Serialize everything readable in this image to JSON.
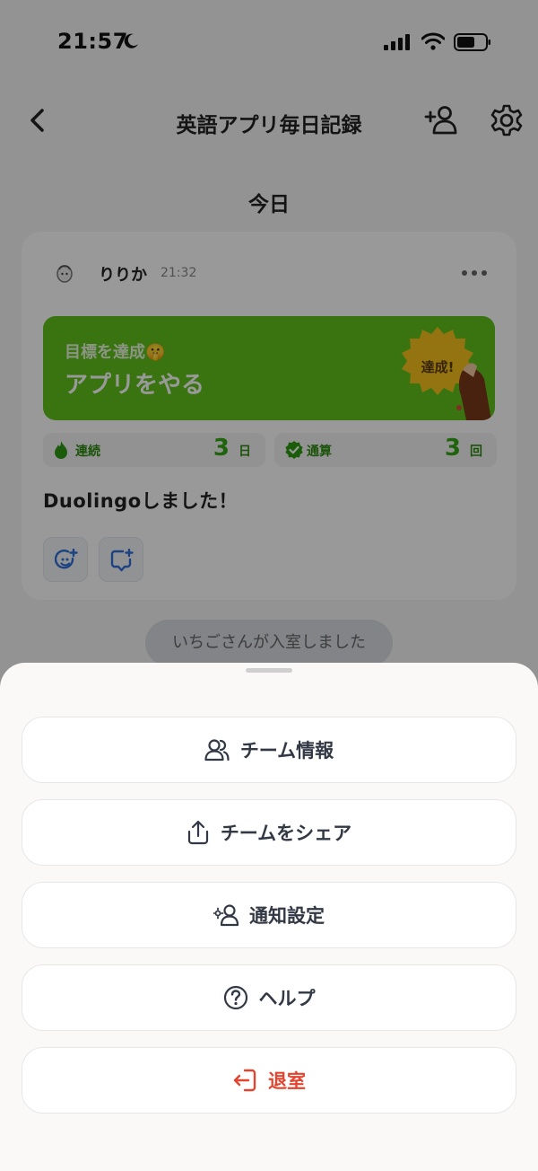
{
  "status_bar": {
    "time": "21:57"
  },
  "nav": {
    "title": "英語アプリ毎日記録"
  },
  "date_label": "今日",
  "post": {
    "username": "りりか",
    "time": "21:32",
    "goal_caption": "目標を達成🤫",
    "goal_title": "アプリをやる",
    "badge_label": "達成!",
    "streak": {
      "label": "連続",
      "value": "3",
      "unit": "日"
    },
    "total": {
      "label": "通算",
      "value": "3",
      "unit": "回"
    },
    "text": "Duolingoしました！"
  },
  "toast": "いちごさんが入室しました",
  "sheet": {
    "items": [
      {
        "label": "チーム情報",
        "icon": "users-icon"
      },
      {
        "label": "チームをシェア",
        "icon": "share-icon"
      },
      {
        "label": "通知設定",
        "icon": "notification-settings-icon"
      },
      {
        "label": "ヘルプ",
        "icon": "help-icon"
      },
      {
        "label": "退室",
        "icon": "leave-icon"
      }
    ]
  },
  "colors": {
    "goal_green": "#5fc21d",
    "stat_green": "#34a615",
    "danger_red": "#e2452f",
    "sheet_text": "#333845"
  }
}
